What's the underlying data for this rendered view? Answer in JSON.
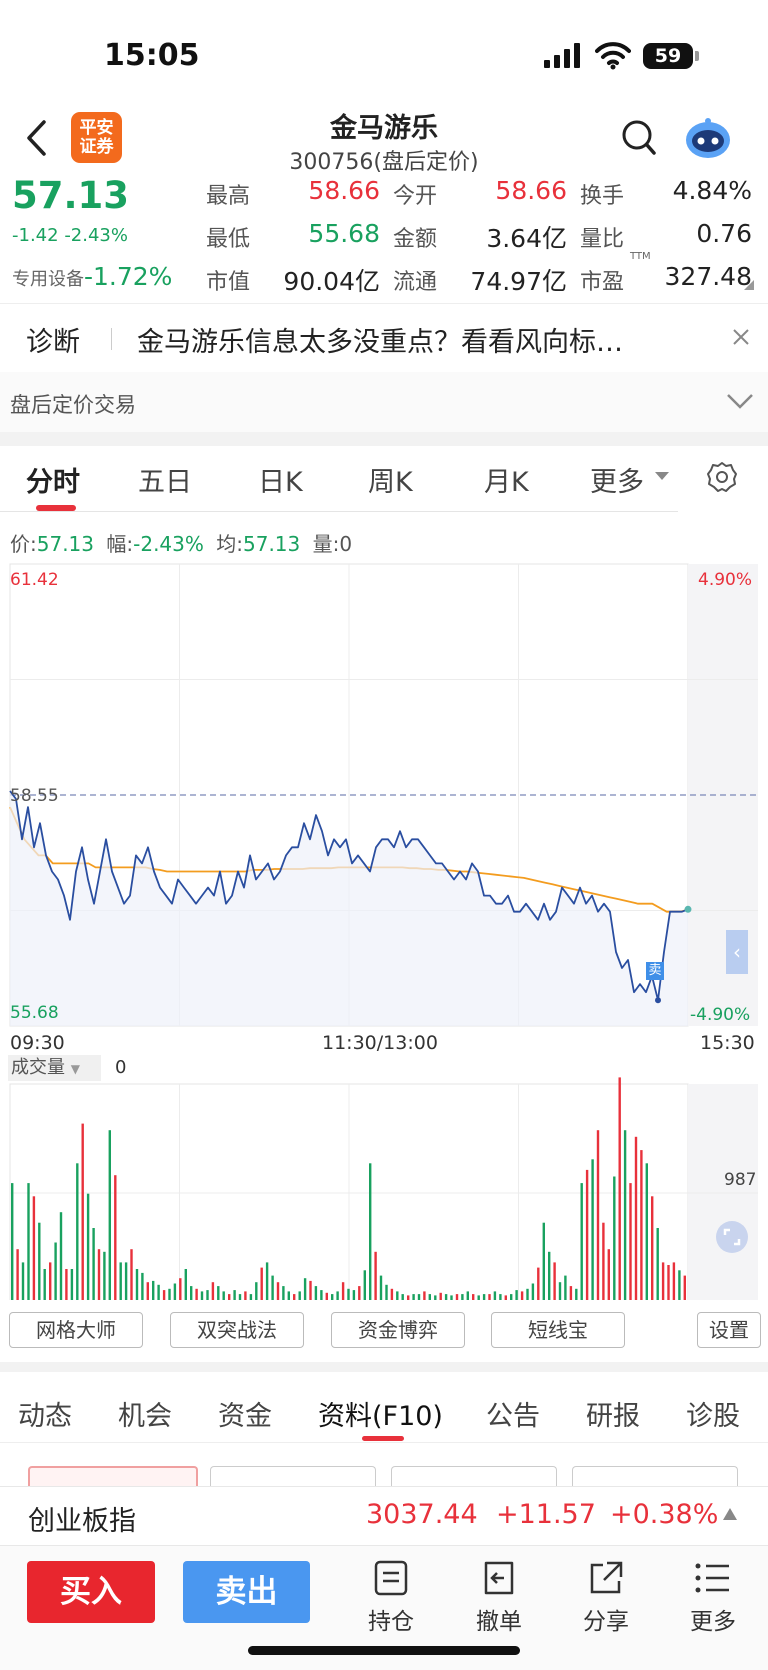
{
  "status_bar": {
    "time": "15:05",
    "battery": "59"
  },
  "header": {
    "logo_text_line1": "平安",
    "logo_text_line2": "证券",
    "title": "金马游乐",
    "subtitle": "300756(盘后定价)"
  },
  "quote": {
    "price": "57.13",
    "change": "-1.42",
    "change_pct": "-2.43%",
    "sector_name": "专用设备",
    "sector_change": "-1.72%",
    "fields": [
      {
        "label": "最高",
        "value": "58.66",
        "color": "#e8313b"
      },
      {
        "label": "今开",
        "value": "58.66",
        "color": "#e8313b"
      },
      {
        "label": "换手",
        "value": "4.84%",
        "color": "#222222"
      },
      {
        "label": "最低",
        "value": "55.68",
        "color": "#19a15f"
      },
      {
        "label": "金额",
        "value": "3.64亿",
        "color": "#222222"
      },
      {
        "label": "量比",
        "value": "0.76",
        "color": "#222222"
      },
      {
        "label": "市值",
        "value": "90.04亿",
        "color": "#222222"
      },
      {
        "label": "流通",
        "value": "74.97亿",
        "color": "#222222"
      },
      {
        "label": "市盈",
        "value": "327.48",
        "color": "#222222"
      }
    ],
    "pe_superscript": "TTM"
  },
  "diagnosis": {
    "label": "诊断",
    "text": "金马游乐信息太多没重点？看看风向标…"
  },
  "after_hours": {
    "label": "盘后定价交易"
  },
  "chart_tabs": [
    "分时",
    "五日",
    "日K",
    "周K",
    "月K",
    "更多"
  ],
  "info_line": {
    "price_label": "价:",
    "price": "57.13",
    "range_label": "幅:",
    "range": "-2.43%",
    "avg_label": "均:",
    "avg": "57.13",
    "vol_label": "量:",
    "vol": "0"
  },
  "chart_labels": {
    "y_top": "61.42",
    "y_mid": "58.55",
    "y_bottom": "55.68",
    "pct_top": "4.90%",
    "pct_bottom": "-4.90%",
    "x_start": "09:30",
    "x_mid": "11:30/13:00",
    "x_end": "15:30",
    "sell_marker": "卖",
    "volume_label": "成交量",
    "volume_value": "0",
    "volume_axis": "987"
  },
  "chart_data": {
    "type": "line",
    "title": "",
    "ylim": [
      55.68,
      61.42
    ],
    "x_ticks": [
      "09:30",
      "11:30/13:00",
      "15:30"
    ],
    "series": [
      {
        "color": "#2a4ea0",
        "values": [
          58.6,
          58.5,
          58.0,
          58.4,
          57.9,
          58.2,
          57.8,
          57.6,
          57.5,
          57.3,
          57.0,
          57.6,
          57.9,
          57.5,
          57.2,
          57.6,
          58.0,
          57.6,
          57.4,
          57.2,
          57.3,
          57.8,
          57.7,
          57.9,
          57.6,
          57.4,
          57.3,
          57.2,
          57.5,
          57.4,
          57.3,
          57.2,
          57.3,
          57.4,
          57.3,
          57.6,
          57.2,
          57.3,
          57.6,
          57.4,
          57.8,
          57.5,
          57.6,
          57.7,
          57.5,
          57.6,
          57.8,
          57.9,
          57.9,
          58.2,
          58.0,
          58.3,
          58.1,
          57.8,
          58.0,
          57.9,
          58.0,
          57.7,
          57.8,
          57.7,
          57.6,
          57.9,
          58.0,
          58.0,
          57.9,
          58.1,
          57.9,
          58.0,
          58.0,
          57.9,
          57.8,
          57.7,
          57.7,
          57.6,
          57.5,
          57.6,
          57.5,
          57.7,
          57.6,
          57.3,
          57.3,
          57.2,
          57.2,
          57.3,
          57.1,
          57.1,
          57.2,
          57.1,
          57.0,
          57.2,
          57.0,
          57.1,
          57.4,
          57.3,
          57.2,
          57.4,
          57.2,
          57.3,
          57.1,
          57.2,
          57.1,
          56.6,
          56.4,
          56.5,
          56.1,
          56.2,
          56.1,
          56.3,
          56.0,
          56.6,
          57.1,
          57.1,
          57.1,
          57.13
        ]
      },
      {
        "color": "#f39c1f",
        "values": [
          58.4,
          58.2,
          58.0,
          57.9,
          57.8,
          57.8,
          57.7,
          57.7,
          57.7,
          57.7,
          57.7,
          57.7,
          57.65,
          57.65,
          57.65,
          57.65,
          57.65,
          57.65,
          57.65,
          57.65,
          57.63,
          57.62,
          57.6,
          57.6,
          57.6,
          57.6,
          57.6,
          57.6,
          57.6,
          57.6,
          57.6,
          57.6,
          57.6,
          57.6,
          57.62,
          57.62,
          57.62,
          57.63,
          57.63,
          57.63,
          57.63,
          57.63,
          57.64,
          57.64,
          57.64,
          57.64,
          57.65,
          57.65,
          57.65,
          57.65,
          57.65,
          57.65,
          57.65,
          57.65,
          57.65,
          57.65,
          57.64,
          57.64,
          57.63,
          57.63,
          57.62,
          57.62,
          57.61,
          57.6,
          57.6,
          57.59,
          57.58,
          57.57,
          57.56,
          57.55,
          57.54,
          57.53,
          57.52,
          57.5,
          57.48,
          57.46,
          57.44,
          57.42,
          57.4,
          57.38,
          57.36,
          57.34,
          57.32,
          57.3,
          57.28,
          57.26,
          57.24,
          57.22,
          57.2,
          57.2,
          57.2,
          57.15,
          57.1,
          57.1,
          57.1,
          57.13
        ]
      }
    ],
    "volume": {
      "ylim": [
        0,
        1650
      ],
      "values": [
        900,
        400,
        300,
        900,
        800,
        600,
        250,
        300,
        450,
        680,
        250,
        250,
        1050,
        1350,
        820,
        560,
        400,
        380,
        1300,
        960,
        300,
        300,
        400,
        250,
        220,
        150,
        160,
        130,
        90,
        100,
        140,
        180,
        250,
        120,
        100,
        80,
        90,
        150,
        120,
        80,
        60,
        90,
        60,
        80,
        60,
        150,
        260,
        300,
        200,
        150,
        120,
        80,
        60,
        80,
        180,
        160,
        120,
        90,
        70,
        60,
        80,
        150,
        100,
        90,
        120,
        240,
        1050,
        380,
        200,
        130,
        100,
        80,
        60,
        50,
        60,
        60,
        80,
        60,
        50,
        70,
        60,
        50,
        60,
        60,
        80,
        60,
        50,
        60,
        60,
        80,
        60,
        50,
        60,
        90,
        80,
        100,
        140,
        260,
        600,
        380,
        300,
        150,
        200,
        120,
        100,
        900,
        1000,
        1080,
        1300,
        600,
        400,
        950,
        1700,
        1300,
        900,
        1250,
        1150,
        1050,
        800,
        560,
        300,
        280,
        300,
        240,
        200
      ]
    }
  },
  "toolbar": [
    "网格大师",
    "双突战法",
    "资金博弈",
    "短线宝"
  ],
  "toolbar_settings": "设置",
  "section_tabs": [
    "动态",
    "机会",
    "资金",
    "资料(F10)",
    "公告",
    "研报",
    "诊股"
  ],
  "index_bar": {
    "name": "创业板指",
    "value": "3037.44",
    "change": "+11.57",
    "pct": "+0.38%"
  },
  "actions": {
    "buy": "买入",
    "sell": "卖出",
    "hold": "持仓",
    "cancel": "撤单",
    "share": "分享",
    "more": "更多"
  }
}
